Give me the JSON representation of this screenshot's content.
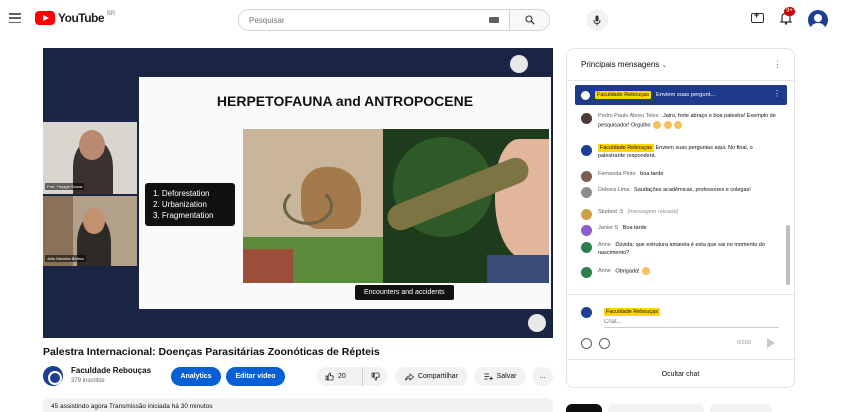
{
  "header": {
    "logo_text": "YouTube",
    "logo_country": "BR",
    "search_placeholder": "Pesquisar",
    "notification_count": "9+"
  },
  "video": {
    "slide_title": "HERPETOFAUNA and ANTROPOCENE",
    "slide_list": [
      "1. Deforestation",
      "2. Urbanization",
      "3. Fragmentation"
    ],
    "slide_caption": "Encounters and accidents",
    "cam1_label": "Prof. Thyago Souza",
    "cam2_label": "Julio Mendes Bellaro"
  },
  "info": {
    "title": "Palestra Internacional: Doenças Parasitárias Zoonóticas de Répteis",
    "channel_name": "Faculdade Rebouças",
    "subscribers": "379 inscritos",
    "analytics_label": "Analytics",
    "edit_label": "Editar vídeo",
    "like_count": "20",
    "share_label": "Compartilhar",
    "save_label": "Salvar",
    "more_label": "...",
    "description": "45 assistindo agora  Transmissão iniciada há 30 minutos"
  },
  "chat": {
    "header_title": "Principais mensagens",
    "pinned_author": "Faculdade Rebouças",
    "pinned_text": "Enviem suas pergunt...",
    "messages": [
      {
        "author": "Pedro Paulo Abreu Teles",
        "text": "Jairo, forte abraço e boa palestra! Exemplo de pesquisador! Orgulho",
        "badge": false,
        "emoji": true
      },
      {
        "author": "Faculdade Rebouças",
        "text": "Enviem suas perguntas aqui. No final, o palestrante responderá.",
        "badge": true,
        "emoji": false
      },
      {
        "author": "Fernanda Pinto",
        "text": "boa tarde",
        "badge": false,
        "emoji": false
      },
      {
        "author": "Debora Lima",
        "text": "Saudações acadêmicas, professores e colegas!",
        "badge": false,
        "emoji": false
      },
      {
        "author": "Student :3",
        "text": "[mensagem retirada]",
        "badge": false,
        "emoji": false,
        "italic": true
      },
      {
        "author": "Janior S",
        "text": "Boa tarde",
        "badge": false,
        "emoji": false
      },
      {
        "author": "Anne",
        "text": "Dúvida: que estrutura amarela é esta que sai no momento do nascimento?",
        "badge": false,
        "emoji": false
      },
      {
        "author": "Anne",
        "text": "Obrigada!",
        "badge": false,
        "emoji": true
      }
    ],
    "input_name": "Faculdade Rebouças",
    "input_placeholder": "Chat...",
    "char_count": "0/200",
    "footer_label": "Ocultar chat"
  },
  "colors": {
    "accent_blue": "#065fd4",
    "badge_yellow": "#ffd600",
    "pinned_bg": "#1e3a8a",
    "brand_red": "#ff0000"
  }
}
